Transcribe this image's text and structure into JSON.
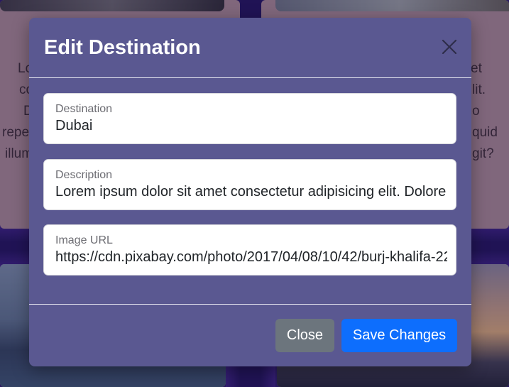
{
  "modal": {
    "title": "Edit Destination",
    "fields": [
      {
        "label": "Destination",
        "value": "Dubai"
      },
      {
        "label": "Description",
        "value": "Lorem ipsum dolor sit amet consectetur adipisicing elit. Dolore"
      },
      {
        "label": "Image URL",
        "value": "https://cdn.pixabay.com/photo/2017/04/08/10/42/burj-khalifa-22"
      }
    ],
    "buttons": {
      "close": "Close",
      "save": "Save Changes"
    }
  },
  "background": {
    "left_card_text": [
      "Lo",
      "co",
      "D",
      "repe",
      "illum"
    ],
    "right_card_text": [
      "et",
      "lit.",
      "o",
      "quid",
      "git?"
    ]
  },
  "colors": {
    "modal_bg": "#5a5891",
    "close_button": "#6c757d",
    "save_button": "#0d6efd",
    "page_bg": "#2a1a6e"
  },
  "icons": {
    "close": "close-icon"
  }
}
